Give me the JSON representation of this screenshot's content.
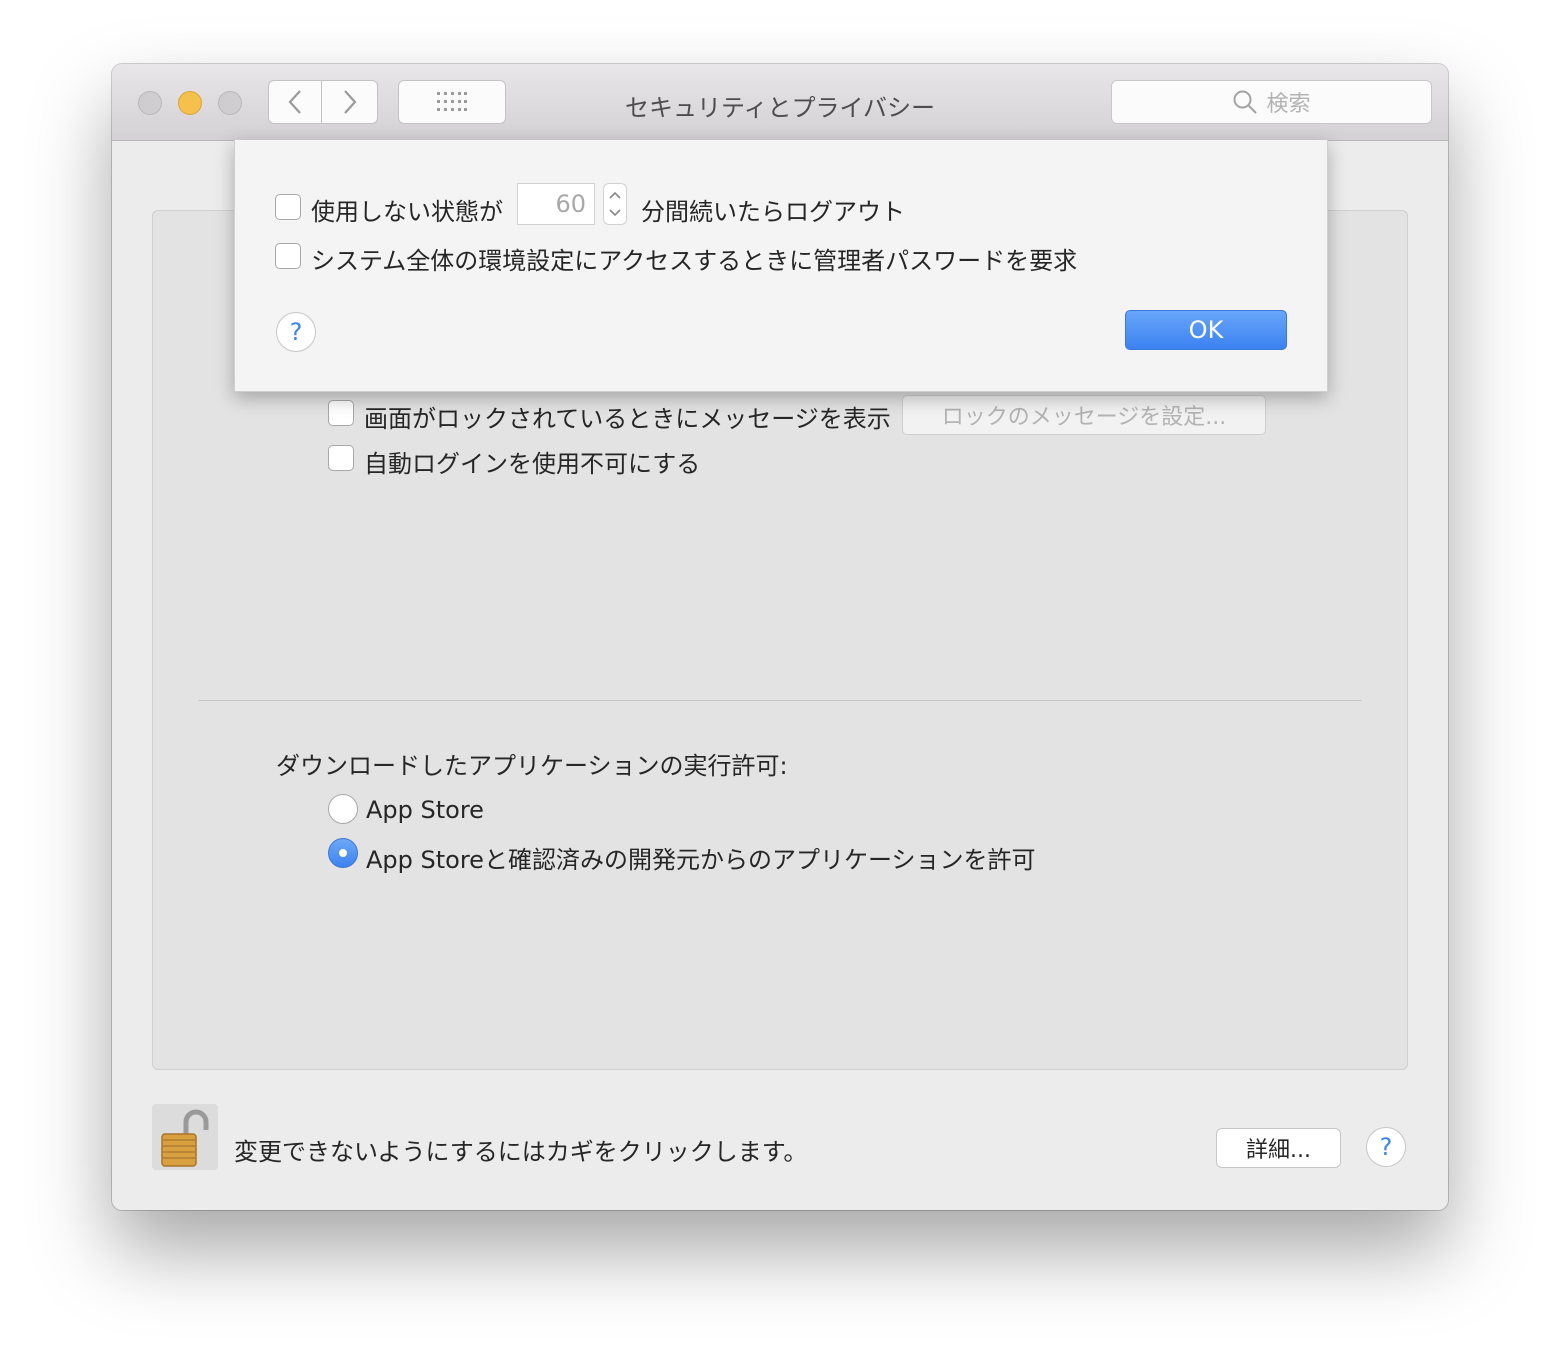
{
  "window": {
    "title": "セキュリティとプライバシー",
    "search_placeholder": "検索"
  },
  "sheet": {
    "logout_label_prefix": "使用しない状態が",
    "logout_minutes": "60",
    "logout_label_suffix": "分間続いたらログアウト",
    "admin_password_label": "システム全体の環境設定にアクセスするときに管理者パスワードを要求",
    "help_symbol": "?",
    "ok_label": "OK"
  },
  "general": {
    "lock_message_label": "画面がロックされているときにメッセージを表示",
    "set_lock_message_button": "ロックのメッセージを設定...",
    "disable_autologin_label": "自動ログインを使用不可にする",
    "download_heading": "ダウンロードしたアプリケーションの実行許可:",
    "radio_app_store": "App Store",
    "radio_app_store_dev": "App Storeと確認済みの開発元からのアプリケーションを許可",
    "selected_radio": "App Storeと確認済みの開発元からのアプリケーションを許可"
  },
  "footer": {
    "lock_text": "変更できないようにするにはカギをクリックします。",
    "details_button": "詳細...",
    "help_symbol": "?"
  },
  "colors": {
    "accent": "#3b82f0",
    "minimize": "#f5c04b"
  }
}
